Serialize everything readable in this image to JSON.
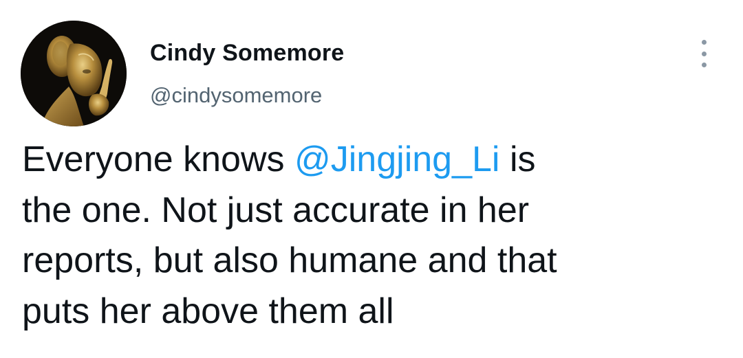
{
  "tweet": {
    "author": {
      "name": "Cindy Somemore",
      "handle": "@cindysomemore"
    },
    "more_icon": "more-vertical-icon",
    "text": {
      "line1_before": "Everyone knows ",
      "mention": "@Jingjing_Li",
      "line1_after": " is",
      "line2": "the one. Not just accurate in her",
      "line3": "reports, but also humane and that",
      "line4": "puts her above them all"
    },
    "colors": {
      "mention": "#1d9bf0",
      "text": "#0f1419",
      "handle": "#536471"
    }
  }
}
